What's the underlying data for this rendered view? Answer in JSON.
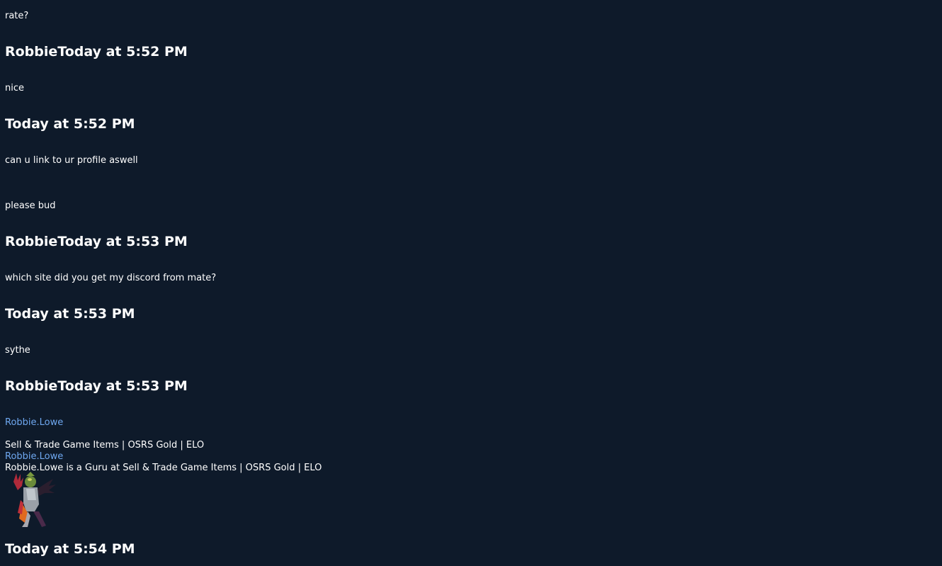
{
  "colors": {
    "background": "#0e1a2a",
    "text": "#ffffff",
    "link": "#6fa8f0"
  },
  "messages": [
    {
      "text": "rate?"
    },
    {
      "header": "RobbieToday at 5:52 PM"
    },
    {
      "text": "nice"
    },
    {
      "header": "Today at 5:52 PM"
    },
    {
      "text": "can u link to ur profile aswell"
    },
    {
      "text": "please bud"
    },
    {
      "header": "RobbieToday at 5:53 PM"
    },
    {
      "text": "which site did you get my discord from mate?"
    },
    {
      "header": "Today at 5:53 PM"
    },
    {
      "text": "sythe"
    },
    {
      "header": "RobbieToday at 5:53 PM"
    }
  ],
  "embed": {
    "link_1": "Robbie.Lowe",
    "group": "Sell & Trade Game Items | OSRS Gold | ELO",
    "link_2": "Robbie.Lowe",
    "description": "Robbie.Lowe is a Guru at Sell & Trade Game Items | OSRS Gold | ELO",
    "avatar_icon": "character-avatar"
  },
  "last_header": "Today at 5:54 PM"
}
